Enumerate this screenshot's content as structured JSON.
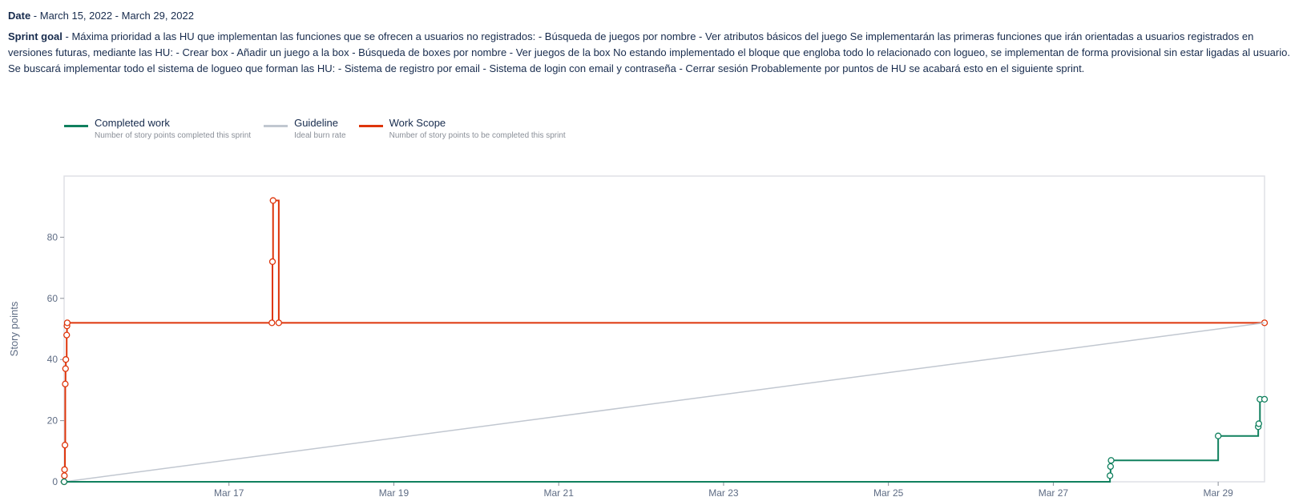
{
  "header": {
    "date_label": "Date",
    "date_value": " - March 15, 2022 - March 29, 2022",
    "goal_label": "Sprint goal",
    "goal_text": " - Máxima prioridad a las HU que implementan las funciones que se ofrecen a usuarios no registrados: - Búsqueda de juegos por nombre - Ver atributos básicos del juego Se implementarán las primeras funciones que irán orientadas a usuarios registrados en versiones futuras, mediante las HU: - Crear box - Añadir un juego a la box - Búsqueda de boxes por nombre - Ver juegos de la box No estando implementado el bloque que engloba todo lo relacionado con logueo, se implementan de forma provisional sin estar ligadas al usuario. Se buscará implementar todo el sistema de logueo que forman las HU: - Sistema de registro por email - Sistema de login con email y contraseña - Cerrar sesión Probablemente por puntos de HU se acabará esto en el siguiente sprint."
  },
  "legend": [
    {
      "title": "Completed work",
      "desc": "Number of story points completed this sprint",
      "color": "#10805e"
    },
    {
      "title": "Guideline",
      "desc": "Ideal burn rate",
      "color": "#c1c7d0"
    },
    {
      "title": "Work Scope",
      "desc": "Number of story points to be completed this sprint",
      "color": "#de350b"
    }
  ],
  "chart_data": {
    "type": "line",
    "ylabel": "Story points",
    "xlabel": "",
    "xlim": [
      "2022-03-15",
      "2022-03-29T13:30"
    ],
    "ylim": [
      0,
      100
    ],
    "x_ticks": [
      "2022-03-17",
      "2022-03-19",
      "2022-03-21",
      "2022-03-23",
      "2022-03-25",
      "2022-03-27",
      "2022-03-29"
    ],
    "x_tick_labels": [
      "Mar 17",
      "Mar 19",
      "Mar 21",
      "Mar 23",
      "Mar 25",
      "Mar 27",
      "Mar 29"
    ],
    "y_ticks": [
      0,
      20,
      40,
      60,
      80
    ],
    "grid": false,
    "legend_position": "top-left",
    "series": [
      {
        "name": "Work Scope",
        "color": "#de350b",
        "step": true,
        "points": [
          {
            "x": "2022-03-15T00:00",
            "y": 0
          },
          {
            "x": "2022-03-15T00:05",
            "y": 2
          },
          {
            "x": "2022-03-15T00:08",
            "y": 4
          },
          {
            "x": "2022-03-15T00:15",
            "y": 12
          },
          {
            "x": "2022-03-15T00:20",
            "y": 32
          },
          {
            "x": "2022-03-15T00:25",
            "y": 37
          },
          {
            "x": "2022-03-15T00:30",
            "y": 40
          },
          {
            "x": "2022-03-15T00:45",
            "y": 48
          },
          {
            "x": "2022-03-15T00:50",
            "y": 51
          },
          {
            "x": "2022-03-15T00:55",
            "y": 52
          },
          {
            "x": "2022-03-17T12:30",
            "y": 52
          },
          {
            "x": "2022-03-17T12:40",
            "y": 72
          },
          {
            "x": "2022-03-17T12:50",
            "y": 92
          },
          {
            "x": "2022-03-17T14:30",
            "y": 52
          },
          {
            "x": "2022-03-29T13:30",
            "y": 52
          }
        ]
      },
      {
        "name": "Guideline",
        "color": "#c1c7d0",
        "step": false,
        "points": [
          {
            "x": "2022-03-15T00:00",
            "y": 0
          },
          {
            "x": "2022-03-29T13:30",
            "y": 52
          }
        ]
      },
      {
        "name": "Completed work",
        "color": "#10805e",
        "step": true,
        "points": [
          {
            "x": "2022-03-15T00:00",
            "y": 0
          },
          {
            "x": "2022-03-27T16:30",
            "y": 2
          },
          {
            "x": "2022-03-27T16:40",
            "y": 5
          },
          {
            "x": "2022-03-27T16:50",
            "y": 7
          },
          {
            "x": "2022-03-29T00:00",
            "y": 15
          },
          {
            "x": "2022-03-29T11:40",
            "y": 18
          },
          {
            "x": "2022-03-29T11:50",
            "y": 19
          },
          {
            "x": "2022-03-29T12:10",
            "y": 27
          },
          {
            "x": "2022-03-29T13:30",
            "y": 27
          }
        ]
      }
    ]
  }
}
